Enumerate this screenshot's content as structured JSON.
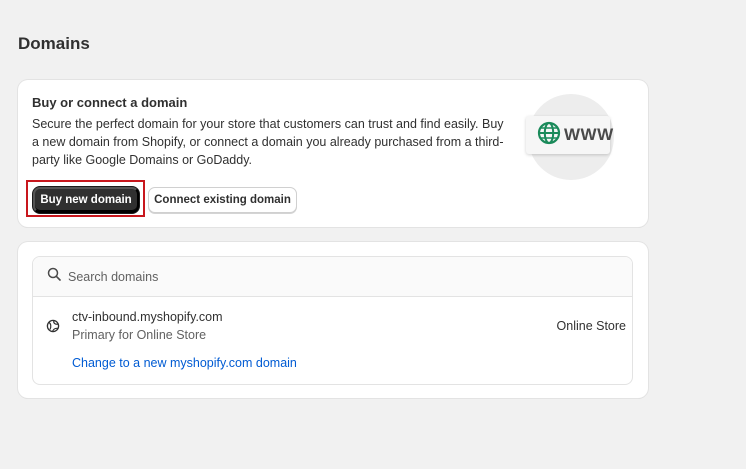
{
  "page": {
    "title": "Domains"
  },
  "promo": {
    "title": "Buy or connect a domain",
    "description": "Secure the perfect domain for your store that customers can trust and find easily. Buy a new domain from Shopify, or connect a domain you already purchased from a third-party like Google Domains or GoDaddy.",
    "buy_button": "Buy new domain",
    "connect_button": "Connect existing domain",
    "illustration": {
      "icon": "globe-icon",
      "text": "WWW"
    }
  },
  "domains": {
    "search_placeholder": "Search domains",
    "items": [
      {
        "name": "ctv-inbound.myshopify.com",
        "subtitle": "Primary for Online Store",
        "target": "Online Store",
        "link": "Change to a new myshopify.com domain",
        "icon": "globe-icon"
      }
    ]
  },
  "colors": {
    "background": "#f1f1f1",
    "primary_button": "#303030",
    "link": "#005bd3",
    "highlight": "#c8171d",
    "globe_green": "#1a8a5a"
  }
}
